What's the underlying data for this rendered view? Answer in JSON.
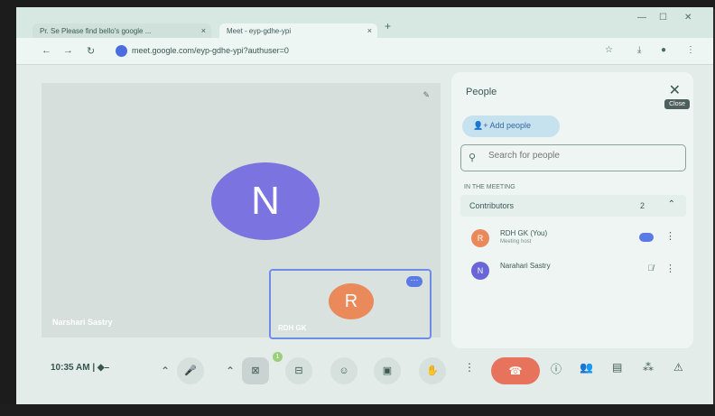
{
  "browser": {
    "tabs": [
      {
        "label": "Pr. Se Please find bello's google ..."
      },
      {
        "label": "Meet - eyp-gdhe-ypi"
      }
    ],
    "new_tab_icon": "plus-icon",
    "url": "meet.google.com/eyp-gdhe-ypi?authuser=0"
  },
  "stage": {
    "main_initial": "N",
    "main_name": "Narshari Sastry",
    "tile_initial": "R",
    "tile_name": "RDH GK"
  },
  "people_panel": {
    "title": "People",
    "close_tooltip": "Close",
    "add_people_label": "Add people",
    "search_placeholder": "Search for people",
    "section_label": "IN THE MEETING",
    "contributors_label": "Contributors",
    "contributors_count": "2",
    "people": [
      {
        "initial": "R",
        "name": "RDH GK (You)",
        "sub": "Meeting host",
        "color": "#ea8a5a"
      },
      {
        "initial": "N",
        "name": "Narahari Sastry",
        "sub": "",
        "color": "#6a66d8"
      }
    ]
  },
  "controls": {
    "time": "10:35 AM",
    "separator": "|",
    "chat_badge": "1"
  },
  "colors": {
    "avatar_n": "#7b74e0",
    "avatar_r": "#ea8a5a",
    "hangup": "#e8735d",
    "accent": "#5a7be6"
  }
}
